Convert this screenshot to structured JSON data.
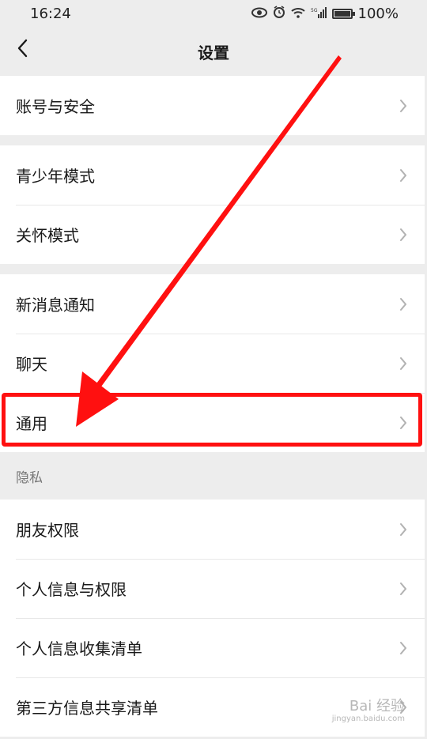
{
  "status_bar": {
    "time": "16:24",
    "battery": "100%",
    "battery_level": 1.0,
    "icons": [
      "eye-icon",
      "alarm-icon",
      "wifi-icon",
      "signal-icon",
      "battery-icon"
    ]
  },
  "nav": {
    "title": "设置",
    "back_icon": "chevron-left-icon"
  },
  "groups": [
    {
      "items": [
        {
          "label": "账号与安全"
        }
      ]
    },
    {
      "items": [
        {
          "label": "青少年模式"
        },
        {
          "label": "关怀模式"
        }
      ]
    },
    {
      "items": [
        {
          "label": "新消息通知"
        },
        {
          "label": "聊天"
        },
        {
          "label": "通用"
        }
      ]
    },
    {
      "header": "隐私",
      "items": [
        {
          "label": "朋友权限"
        },
        {
          "label": "个人信息与权限"
        },
        {
          "label": "个人信息收集清单"
        },
        {
          "label": "第三方信息共享清单"
        }
      ]
    }
  ],
  "annotation": {
    "highlight_target": "通用",
    "color": "#ff1010"
  },
  "watermark": {
    "text": "Bai 经验",
    "url": "jingyan.baidu.com"
  }
}
